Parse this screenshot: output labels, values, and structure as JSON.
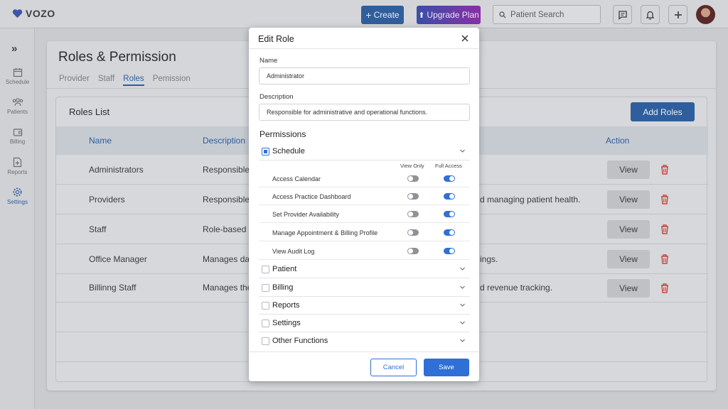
{
  "app": {
    "logo_text": "VOZO"
  },
  "topbar": {
    "create_label": "Create",
    "upgrade_label": "Upgrade Plan",
    "search_placeholder": "Patient Search"
  },
  "sidebar": {
    "items": [
      {
        "label": "Schedule",
        "icon": "calendar-icon"
      },
      {
        "label": "Patients",
        "icon": "users-icon"
      },
      {
        "label": "Billing",
        "icon": "wallet-icon"
      },
      {
        "label": "Reports",
        "icon": "report-icon"
      },
      {
        "label": "Settings",
        "icon": "gear-icon",
        "active": true
      }
    ]
  },
  "page": {
    "title": "Roles & Permission",
    "tabs": [
      "Provider",
      "Staff",
      "Roles",
      "Pemission"
    ],
    "active_tab": "Roles"
  },
  "roles_list": {
    "title": "Roles List",
    "add_label": "Add Roles",
    "columns": [
      "Name",
      "Description",
      "Action"
    ],
    "view_label": "View",
    "rows": [
      {
        "name": "Administrators",
        "desc_left": "Responsible f",
        "desc_right": ""
      },
      {
        "name": "Providers",
        "desc_left": "Responsible f",
        "desc_right": "d managing patient health."
      },
      {
        "name": "Staff",
        "desc_left": "Role-based ac",
        "desc_right": ""
      },
      {
        "name": "Office Manager",
        "desc_left": "Manages day-",
        "desc_right": "ings."
      },
      {
        "name": "Billinng Staff",
        "desc_left": "Manages the",
        "desc_right": "d revenue tracking."
      }
    ]
  },
  "modal": {
    "title": "Edit Role",
    "name_label": "Name",
    "name_value": "Administrator",
    "description_label": "Description",
    "description_value": "Responsible for administrative and operational functions.",
    "permissions_title": "Permissions",
    "view_only_label": "View Only",
    "full_access_label": "Full Access",
    "schedule_section": "Schedule",
    "schedule_permissions": [
      {
        "label": "Access Calendar",
        "view_only": false,
        "full_access": true
      },
      {
        "label": "Access Practice Dashboard",
        "view_only": false,
        "full_access": true
      },
      {
        "label": "Set Provider Availability",
        "view_only": false,
        "full_access": true
      },
      {
        "label": "Manage Appointment & Billing Profile",
        "view_only": false,
        "full_access": true
      },
      {
        "label": "View Audit Log",
        "view_only": false,
        "full_access": true
      }
    ],
    "other_sections": [
      "Patient",
      "Billing",
      "Reports",
      "Settings",
      "Other Functions"
    ],
    "cancel_label": "Cancel",
    "save_label": "Save"
  },
  "colors": {
    "primary": "#2f6fd6",
    "accent_dim": "#2f5e9c",
    "danger": "#d9534f"
  }
}
